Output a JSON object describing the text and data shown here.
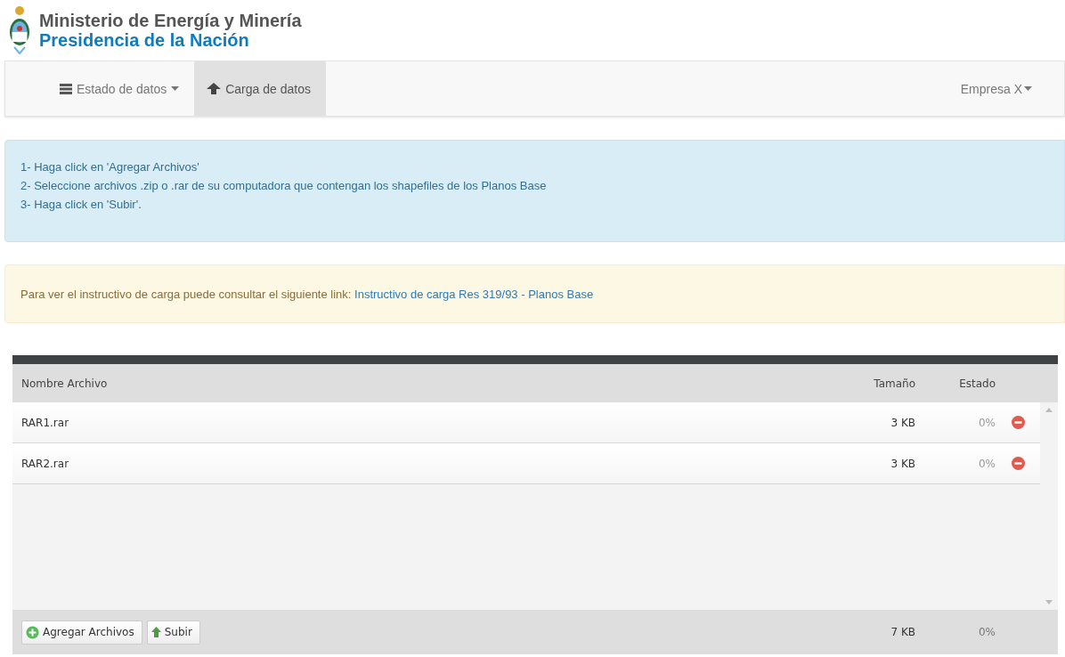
{
  "header": {
    "title": "Ministerio de Energía y Minería",
    "subtitle": "Presidencia de la Nación"
  },
  "nav": {
    "items": [
      {
        "label": "Estado de datos",
        "kind": "server",
        "dropdown": true,
        "selected": false
      },
      {
        "label": "Carga de datos",
        "kind": "upload",
        "dropdown": false,
        "selected": true
      }
    ],
    "user_menu": {
      "label": "Empresa X",
      "dropdown": true
    }
  },
  "info_alert": {
    "lines": [
      "1- Haga click en 'Agregar Archivos'",
      "2- Seleccione archivos .zip o .rar de su computadora que contengan los shapefiles de los Planos Base",
      "3- Haga click en 'Subir'."
    ]
  },
  "warning_alert": {
    "text": "Para ver el instructivo de carga puede consultar el siguiente link:",
    "link": "Instructivo de carga Res 319/93 - Planos Base"
  },
  "uploader": {
    "columns": [
      "Nombre Archivo",
      "Tamaño",
      "Estado"
    ],
    "rows": [
      {
        "name": "RAR1.rar",
        "size": "3 KB",
        "status": "0%"
      },
      {
        "name": "RAR2.rar",
        "size": "3 KB",
        "status": "0%"
      }
    ],
    "buttons": [
      {
        "label": "Agregar Archivos",
        "kind": "add"
      },
      {
        "label": "Subir",
        "kind": "upload"
      }
    ],
    "total_size": "7 KB",
    "total_status": "0%"
  }
}
